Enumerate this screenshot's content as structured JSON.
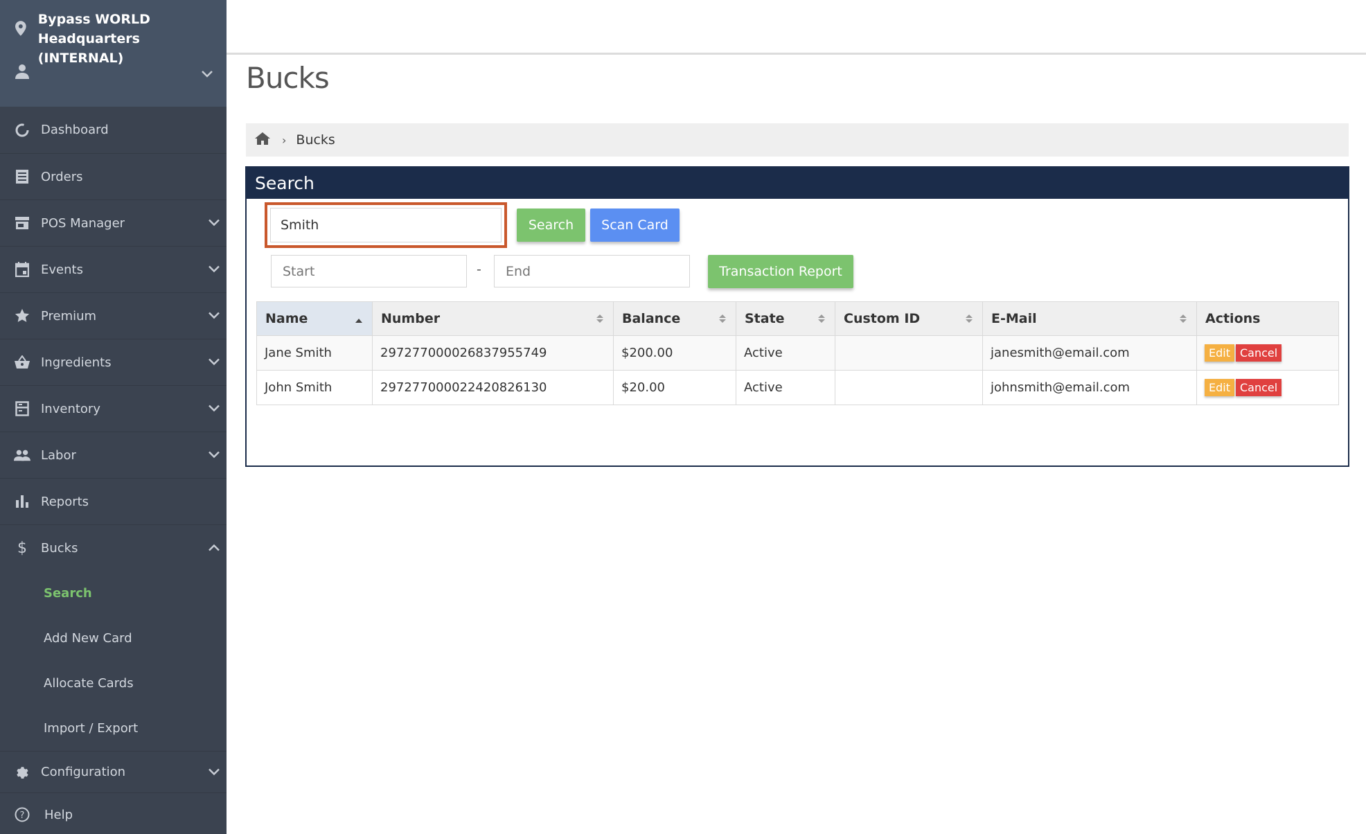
{
  "sidebar": {
    "location": "Bypass WORLD Headquarters (INTERNAL)",
    "location_line1": "Bypass WORLD",
    "location_line2": "Headquarters (INTERNAL)",
    "items": [
      {
        "label": "Dashboard",
        "icon": "dashboard-icon"
      },
      {
        "label": "Orders",
        "icon": "orders-icon"
      },
      {
        "label": "POS Manager",
        "icon": "pos-manager-icon"
      },
      {
        "label": "Events",
        "icon": "calendar-icon"
      },
      {
        "label": "Premium",
        "icon": "star-icon"
      },
      {
        "label": "Ingredients",
        "icon": "basket-icon"
      },
      {
        "label": "Inventory",
        "icon": "inventory-icon"
      },
      {
        "label": "Labor",
        "icon": "people-icon"
      },
      {
        "label": "Reports",
        "icon": "bar-chart-icon"
      },
      {
        "label": "Bucks",
        "icon": "dollar-icon"
      }
    ],
    "bucks_sub": [
      {
        "label": "Search",
        "active": true
      },
      {
        "label": "Add New Card"
      },
      {
        "label": "Allocate Cards"
      },
      {
        "label": "Import / Export"
      }
    ],
    "configuration": "Configuration",
    "help": "Help"
  },
  "page": {
    "title": "Bucks",
    "breadcrumb": [
      "Bucks"
    ]
  },
  "panel": {
    "title": "Search",
    "search_value": "Smith",
    "search_button": "Search",
    "scan_button": "Scan Card",
    "start_placeholder": "Start",
    "date_separator": "-",
    "end_placeholder": "End",
    "report_button": "Transaction Report"
  },
  "table": {
    "columns": [
      "Name",
      "Number",
      "Balance",
      "State",
      "Custom ID",
      "E-Mail",
      "Actions"
    ],
    "rows": [
      {
        "name": "Jane Smith",
        "number": "297277000026837955749",
        "balance": "$200.00",
        "state": "Active",
        "custom_id": "",
        "email": "janesmith@email.com",
        "edit": "Edit",
        "cancel": "Cancel"
      },
      {
        "name": "John Smith",
        "number": "297277000022420826130",
        "balance": "$20.00",
        "state": "Active",
        "custom_id": "",
        "email": "johnsmith@email.com",
        "edit": "Edit",
        "cancel": "Cancel"
      }
    ]
  },
  "colors": {
    "sidebar_bg": "#3b4350",
    "panel_header": "#1b2c4a",
    "accent_green": "#7cc36e",
    "accent_blue": "#5b8ff2",
    "highlight_border": "#c9582c",
    "edit_orange": "#f5b042",
    "cancel_red": "#e0403f"
  }
}
